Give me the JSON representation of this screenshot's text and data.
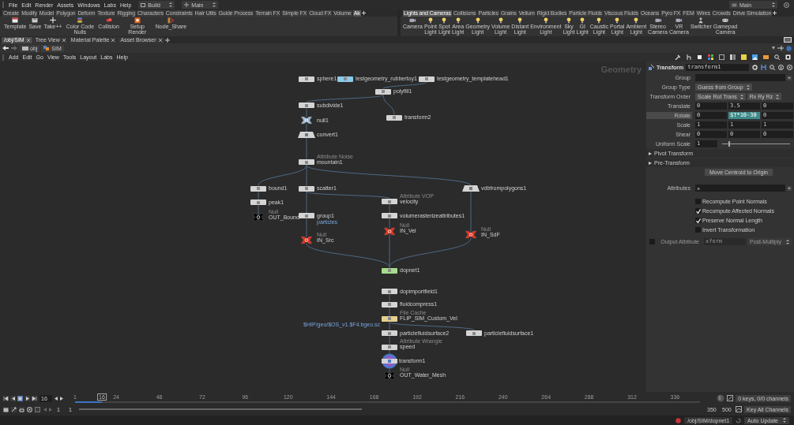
{
  "menu_bar": {
    "items": [
      "File",
      "Edit",
      "Render",
      "Assets",
      "Windows",
      "Labs",
      "Help"
    ],
    "desktop": "Build",
    "workspace": "Main",
    "right_workspace": "Main"
  },
  "shelf_left": {
    "tabs": [
      {
        "label": "Create",
        "selected": false
      },
      {
        "label": "Modify",
        "selected": false
      },
      {
        "label": "Model",
        "selected": false
      },
      {
        "label": "Polygon",
        "selected": false
      },
      {
        "label": "Deform",
        "selected": false
      },
      {
        "label": "Texture",
        "selected": false
      },
      {
        "label": "Rigging",
        "selected": false
      },
      {
        "label": "Characters",
        "selected": false
      },
      {
        "label": "Constraints",
        "selected": false
      },
      {
        "label": "Hair Utils",
        "selected": false
      },
      {
        "label": "Guide Process",
        "selected": false
      },
      {
        "label": "Terrain FX",
        "selected": false
      },
      {
        "label": "Simple FX",
        "selected": false
      },
      {
        "label": "Cloud FX",
        "selected": false
      },
      {
        "label": "Volume",
        "selected": false
      },
      {
        "label": "Ak",
        "selected": true
      }
    ],
    "tools": [
      "Template",
      "Save",
      "Take++",
      "Color Code Nulls",
      "Collision",
      "Setup Render",
      "Node_Share"
    ]
  },
  "shelf_right": {
    "tabs": [
      {
        "label": "Lights and Cameras",
        "selected": true
      },
      {
        "label": "Collisions",
        "selected": false
      },
      {
        "label": "Particles",
        "selected": false
      },
      {
        "label": "Grains",
        "selected": false
      },
      {
        "label": "Vellum",
        "selected": false
      },
      {
        "label": "Rigid Bodies",
        "selected": false
      },
      {
        "label": "Particle Fluids",
        "selected": false
      },
      {
        "label": "Viscous Fluids",
        "selected": false
      },
      {
        "label": "Oceans",
        "selected": false
      },
      {
        "label": "Pyro FX",
        "selected": false
      },
      {
        "label": "FEM",
        "selected": false
      },
      {
        "label": "Wires",
        "selected": false
      },
      {
        "label": "Crowds",
        "selected": false
      },
      {
        "label": "Drive Simulation",
        "selected": false
      }
    ],
    "tools": [
      "Camera",
      "Point Light",
      "Spot Light",
      "Area Light",
      "Geometry Light",
      "Volume Light",
      "Distant Light",
      "Environment Light",
      "Sky Light",
      "GI Light",
      "Caustic Light",
      "Portal Light",
      "Ambient Light",
      "Stereo Camera",
      "VR Camera",
      "Switcher",
      "Gamepad Camera"
    ]
  },
  "pane_tabs": [
    {
      "label": "/obj/SIM",
      "selected": true
    },
    {
      "label": "Tree View",
      "selected": false
    },
    {
      "label": "Material Palette",
      "selected": false
    },
    {
      "label": "Asset Browser",
      "selected": false
    }
  ],
  "path": [
    "obj",
    "SIM"
  ],
  "network_menu": [
    "Add",
    "Edit",
    "Go",
    "View",
    "Tools",
    "Layout",
    "Labs",
    "Help"
  ],
  "network": {
    "context": "Geometry",
    "nodes": [
      {
        "name": "sphere1",
        "kind": "box",
        "color": "#d4d4d4"
      },
      {
        "name": "testgeometry_rubbertoy1",
        "kind": "box",
        "color": "#8ccbea"
      },
      {
        "name": "testgeometry_templatehead1",
        "kind": "box",
        "color": "#d4d4d4"
      },
      {
        "name": "polyfill1",
        "kind": "box",
        "color": "#d4d4d4"
      },
      {
        "name": "subdivide1",
        "kind": "box",
        "color": "#d4d4d4"
      },
      {
        "name": "transform2",
        "kind": "box",
        "color": "#d4d4d4"
      },
      {
        "name": "null1",
        "kind": "null",
        "color": "#9fbbd6"
      },
      {
        "name": "convert1",
        "kind": "bulge",
        "color": "#d4d4d4"
      },
      {
        "name": "mountain1",
        "type_label": "Attribute Noise",
        "kind": "box",
        "color": "#d4d4d4"
      },
      {
        "name": "bound1",
        "kind": "box",
        "color": "#d4d4d4"
      },
      {
        "name": "scatter1",
        "kind": "box",
        "color": "#d4d4d4"
      },
      {
        "name": "vdbfrompolygons1",
        "kind": "bulge",
        "color": "#d4d4d4"
      },
      {
        "name": "peak1",
        "kind": "box",
        "color": "#d4d4d4"
      },
      {
        "name": "velocity",
        "type_label": "Attribute VOP",
        "kind": "box",
        "color": "#d4d4d4"
      },
      {
        "name": "OUT_Bound",
        "type_label": "Null",
        "kind": "null",
        "color": "#000000"
      },
      {
        "name": "group1",
        "note": "particles",
        "kind": "box",
        "color": "#d4d4d4"
      },
      {
        "name": "volumerasterizeattributes1",
        "kind": "box",
        "color": "#d4d4d4"
      },
      {
        "name": "IN_Vel",
        "type_label": "Null",
        "kind": "null",
        "color": "#e8321e"
      },
      {
        "name": "IN_Src",
        "type_label": "Null",
        "kind": "null",
        "color": "#e8321e"
      },
      {
        "name": "IN_SdF",
        "type_label": "Null",
        "kind": "null",
        "color": "#e8321e"
      },
      {
        "name": "dopnet1",
        "kind": "box",
        "color": "#a6dd8a"
      },
      {
        "name": "dopimportfield1",
        "kind": "box",
        "color": "#d4d4d4"
      },
      {
        "name": "fluidcompress1",
        "kind": "box",
        "color": "#d4d4d4"
      },
      {
        "name": "FLIP_SIM_Custom_Vel",
        "type_label": "File Cache",
        "note": "$HIP/geo/$OS_v1.$F4.bgeo.sc",
        "kind": "box",
        "color": "#e6cf8e"
      },
      {
        "name": "particlefluidsurface2",
        "kind": "box",
        "color": "#d4d4d4"
      },
      {
        "name": "particlefluidsurface1",
        "kind": "box",
        "color": "#d4d4d4"
      },
      {
        "name": "speed",
        "type_label": "Attribute Wrangle",
        "kind": "box",
        "color": "#d4d4d4"
      },
      {
        "name": "transform1",
        "kind": "display",
        "color": "#d4d4d4"
      },
      {
        "name": "OUT_Water_Mesh",
        "type_label": "Null",
        "kind": "null",
        "color": "#000000"
      }
    ]
  },
  "parameters": {
    "type_label": "Transform",
    "node_name": "transform1",
    "rows": [
      {
        "kind": "field",
        "label": "Group",
        "menu": true
      },
      {
        "kind": "menu",
        "label": "Group Type",
        "menus": [
          "Guess from Group"
        ]
      },
      {
        "kind": "menu",
        "label": "Transform Order",
        "menus": [
          "Scale Rot Trans",
          "Rx Ry Rz"
        ]
      },
      {
        "kind": "vector",
        "label": "Translate",
        "highlighted": false,
        "values": [
          {
            "text": "0",
            "expression": false
          },
          {
            "text": "3.5",
            "expression": false
          },
          {
            "text": "0",
            "expression": false
          }
        ]
      },
      {
        "kind": "vector",
        "label": "Rotate",
        "highlighted": true,
        "values": [
          {
            "text": "0",
            "expression": false
          },
          {
            "text": "$T*10-30",
            "expression": true
          },
          {
            "text": "0",
            "expression": false
          }
        ]
      },
      {
        "kind": "vector",
        "label": "Scale",
        "highlighted": false,
        "values": [
          {
            "text": "1",
            "expression": false
          },
          {
            "text": "1",
            "expression": false
          },
          {
            "text": "1",
            "expression": false
          }
        ]
      },
      {
        "kind": "vector",
        "label": "Shear",
        "highlighted": false,
        "values": [
          {
            "text": "0",
            "expression": false
          },
          {
            "text": "0",
            "expression": false
          },
          {
            "text": "0",
            "expression": false
          }
        ]
      },
      {
        "kind": "slider",
        "label": "Uniform Scale",
        "value": "1",
        "level": 0.1
      },
      {
        "kind": "folder",
        "label": "Pivot Transform",
        "expanded": false
      },
      {
        "kind": "folder",
        "label": "Pre-Transform",
        "expanded": false
      },
      {
        "kind": "button",
        "label": "Move Centroid to Origin"
      },
      {
        "kind": "field",
        "label": "Attributes",
        "value": "*",
        "menu": true
      },
      {
        "kind": "checkbox",
        "label": "Recompute Point Normals",
        "checked": false
      },
      {
        "kind": "checkbox",
        "label": "Recompute Affected Normals",
        "checked": true
      },
      {
        "kind": "checkbox",
        "label": "Preserve Normal Length",
        "checked": true
      },
      {
        "kind": "checkbox",
        "label": "Invert Transformation",
        "checked": false
      },
      {
        "kind": "output",
        "label": "Output Attribute",
        "checked": false,
        "placeholder": "xform",
        "menu_value": "Post-Multiply"
      }
    ]
  },
  "timeline": {
    "frame": "16",
    "playhead": {
      "label": "16"
    },
    "played": {
      "level": 0.043
    },
    "ticks": [
      "1",
      "24",
      "48",
      "72",
      "96",
      "120",
      "144",
      "168",
      "192",
      "216",
      "240",
      "264",
      "288",
      "312",
      "336"
    ],
    "start": "1",
    "range_start": "1",
    "range_end": "350",
    "end": "500",
    "keys_info": "0 keys, 0/0 channels",
    "key_button": "Key All Channels",
    "range_bar": {
      "level": 0.64
    }
  },
  "status_bar": {
    "path": "/obj/SIM/dopnet1",
    "update_mode": "Auto Update"
  }
}
